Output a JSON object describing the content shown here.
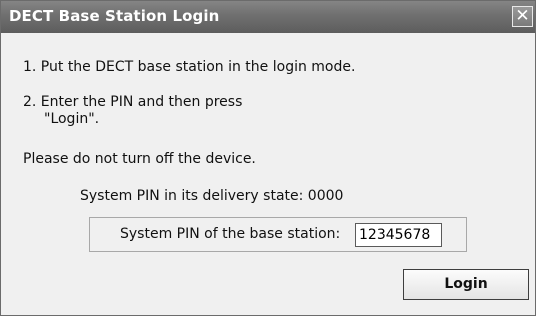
{
  "window": {
    "title": "DECT Base Station Login",
    "close_icon": "close-icon",
    "close_glyph": "✕"
  },
  "instructions": {
    "step1": "1. Put the DECT base station in the login mode.",
    "step2_line1": "2. Enter the PIN and then press",
    "step2_line2": "\"Login\".",
    "warning": "Please do not turn off the device."
  },
  "pin": {
    "delivery_text": "System PIN in its delivery state: 0000",
    "label": "System PIN of the base station:",
    "value": "12345678"
  },
  "buttons": {
    "login_label": "Login"
  },
  "colors": {
    "titlebar": "#6f6f6f",
    "title_text": "#ffffff",
    "background": "#f0f0f0"
  }
}
